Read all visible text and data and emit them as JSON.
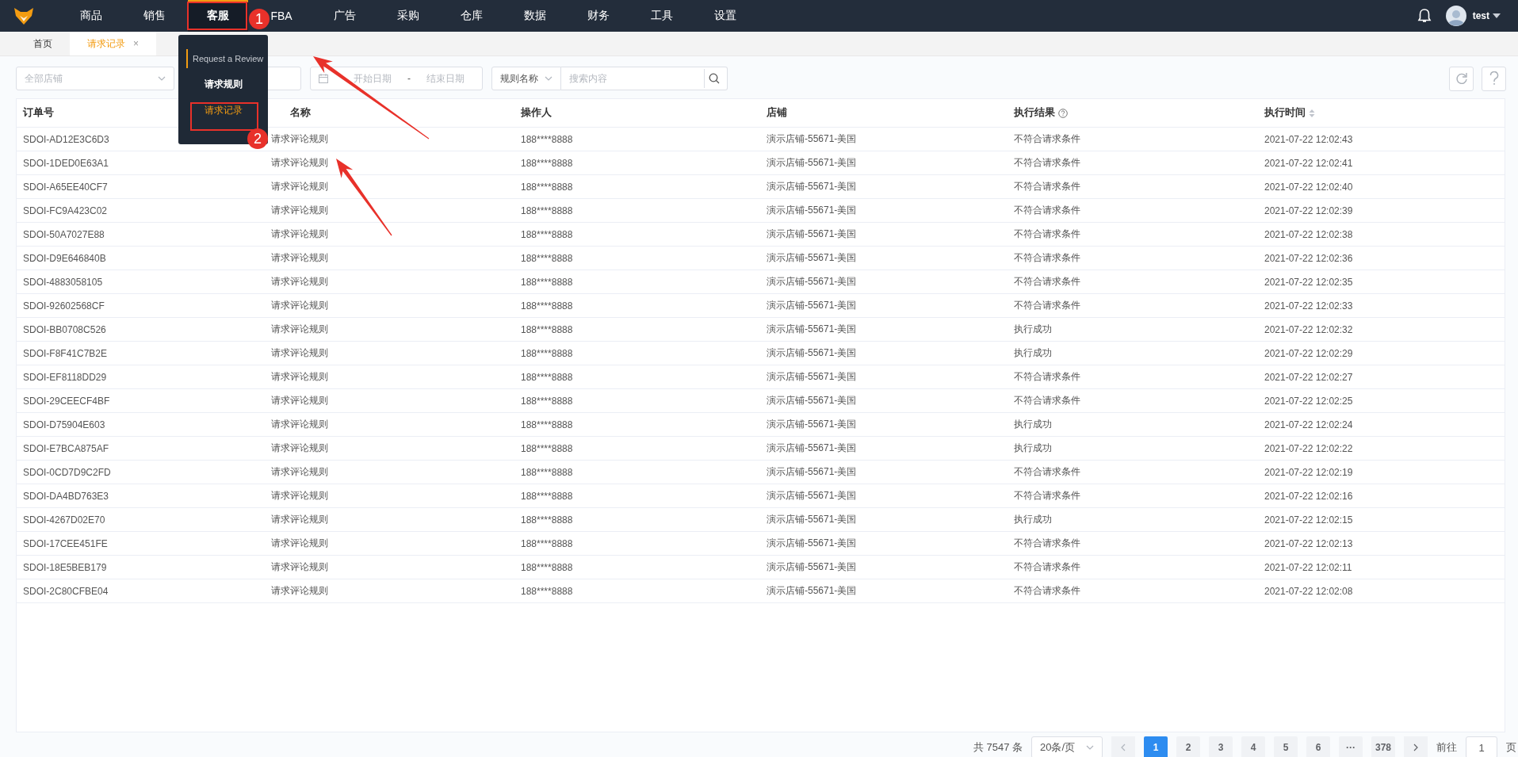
{
  "nav": {
    "items": [
      {
        "label": "商品",
        "selected": false
      },
      {
        "label": "销售",
        "selected": false
      },
      {
        "label": "客服",
        "selected": true
      },
      {
        "label": "FBA",
        "selected": false
      },
      {
        "label": "广告",
        "selected": false
      },
      {
        "label": "采购",
        "selected": false
      },
      {
        "label": "仓库",
        "selected": false
      },
      {
        "label": "数据",
        "selected": false
      },
      {
        "label": "财务",
        "selected": false
      },
      {
        "label": "工具",
        "selected": false
      },
      {
        "label": "设置",
        "selected": false
      }
    ],
    "user": "test"
  },
  "dropdown": {
    "section": "Request a Review",
    "items": [
      {
        "label": "请求规则",
        "selected": false
      },
      {
        "label": "请求记录",
        "selected": true
      }
    ]
  },
  "tabs": [
    {
      "label": "首页",
      "selected": false
    },
    {
      "label": "请求记录",
      "selected": true,
      "close": "×"
    }
  ],
  "filters": {
    "shop": {
      "placeholder": "全部店铺"
    },
    "date_start": {
      "placeholder": "开始日期"
    },
    "date_sep": "-",
    "date_end": {
      "placeholder": "结束日期"
    },
    "search_type": "规则名称",
    "search": {
      "placeholder": "搜索内容"
    }
  },
  "table": {
    "columns": [
      "订单号",
      "名称",
      "操作人",
      "店铺",
      "执行结果",
      "执行时间"
    ],
    "rows": [
      [
        "SDOI-AD12E3C6D3",
        "请求评论规则",
        "188****8888",
        "演示店铺-55671-美国",
        "不符合请求条件",
        "2021-07-22 12:02:43"
      ],
      [
        "SDOI-1DED0E63A1",
        "请求评论规则",
        "188****8888",
        "演示店铺-55671-美国",
        "不符合请求条件",
        "2021-07-22 12:02:41"
      ],
      [
        "SDOI-A65EE40CF7",
        "请求评论规则",
        "188****8888",
        "演示店铺-55671-美国",
        "不符合请求条件",
        "2021-07-22 12:02:40"
      ],
      [
        "SDOI-FC9A423C02",
        "请求评论规则",
        "188****8888",
        "演示店铺-55671-美国",
        "不符合请求条件",
        "2021-07-22 12:02:39"
      ],
      [
        "SDOI-50A7027E88",
        "请求评论规则",
        "188****8888",
        "演示店铺-55671-美国",
        "不符合请求条件",
        "2021-07-22 12:02:38"
      ],
      [
        "SDOI-D9E646840B",
        "请求评论规则",
        "188****8888",
        "演示店铺-55671-美国",
        "不符合请求条件",
        "2021-07-22 12:02:36"
      ],
      [
        "SDOI-4883058105",
        "请求评论规则",
        "188****8888",
        "演示店铺-55671-美国",
        "不符合请求条件",
        "2021-07-22 12:02:35"
      ],
      [
        "SDOI-92602568CF",
        "请求评论规则",
        "188****8888",
        "演示店铺-55671-美国",
        "不符合请求条件",
        "2021-07-22 12:02:33"
      ],
      [
        "SDOI-BB0708C526",
        "请求评论规则",
        "188****8888",
        "演示店铺-55671-美国",
        "执行成功",
        "2021-07-22 12:02:32"
      ],
      [
        "SDOI-F8F41C7B2E",
        "请求评论规则",
        "188****8888",
        "演示店铺-55671-美国",
        "执行成功",
        "2021-07-22 12:02:29"
      ],
      [
        "SDOI-EF8118DD29",
        "请求评论规则",
        "188****8888",
        "演示店铺-55671-美国",
        "不符合请求条件",
        "2021-07-22 12:02:27"
      ],
      [
        "SDOI-29CEECF4BF",
        "请求评论规则",
        "188****8888",
        "演示店铺-55671-美国",
        "不符合请求条件",
        "2021-07-22 12:02:25"
      ],
      [
        "SDOI-D75904E603",
        "请求评论规则",
        "188****8888",
        "演示店铺-55671-美国",
        "执行成功",
        "2021-07-22 12:02:24"
      ],
      [
        "SDOI-E7BCA875AF",
        "请求评论规则",
        "188****8888",
        "演示店铺-55671-美国",
        "执行成功",
        "2021-07-22 12:02:22"
      ],
      [
        "SDOI-0CD7D9C2FD",
        "请求评论规则",
        "188****8888",
        "演示店铺-55671-美国",
        "不符合请求条件",
        "2021-07-22 12:02:19"
      ],
      [
        "SDOI-DA4BD763E3",
        "请求评论规则",
        "188****8888",
        "演示店铺-55671-美国",
        "不符合请求条件",
        "2021-07-22 12:02:16"
      ],
      [
        "SDOI-4267D02E70",
        "请求评论规则",
        "188****8888",
        "演示店铺-55671-美国",
        "执行成功",
        "2021-07-22 12:02:15"
      ],
      [
        "SDOI-17CEE451FE",
        "请求评论规则",
        "188****8888",
        "演示店铺-55671-美国",
        "不符合请求条件",
        "2021-07-22 12:02:13"
      ],
      [
        "SDOI-18E5BEB179",
        "请求评论规则",
        "188****8888",
        "演示店铺-55671-美国",
        "不符合请求条件",
        "2021-07-22 12:02:11"
      ],
      [
        "SDOI-2C80CFBE04",
        "请求评论规则",
        "188****8888",
        "演示店铺-55671-美国",
        "不符合请求条件",
        "2021-07-22 12:02:08"
      ]
    ]
  },
  "pagination": {
    "total": "共 7547 条",
    "page_size": "20条/页",
    "pages": [
      {
        "label": "1",
        "selected": true
      },
      {
        "label": "2",
        "selected": false
      },
      {
        "label": "3",
        "selected": false
      },
      {
        "label": "4",
        "selected": false
      },
      {
        "label": "5",
        "selected": false
      },
      {
        "label": "6",
        "selected": false
      },
      {
        "label": "···",
        "selected": false
      },
      {
        "label": "378",
        "selected": false
      }
    ],
    "goto_label": "前往",
    "goto_value": "1",
    "goto_suffix": "页"
  },
  "annotations": [
    {
      "label": "1"
    },
    {
      "label": "2"
    }
  ]
}
